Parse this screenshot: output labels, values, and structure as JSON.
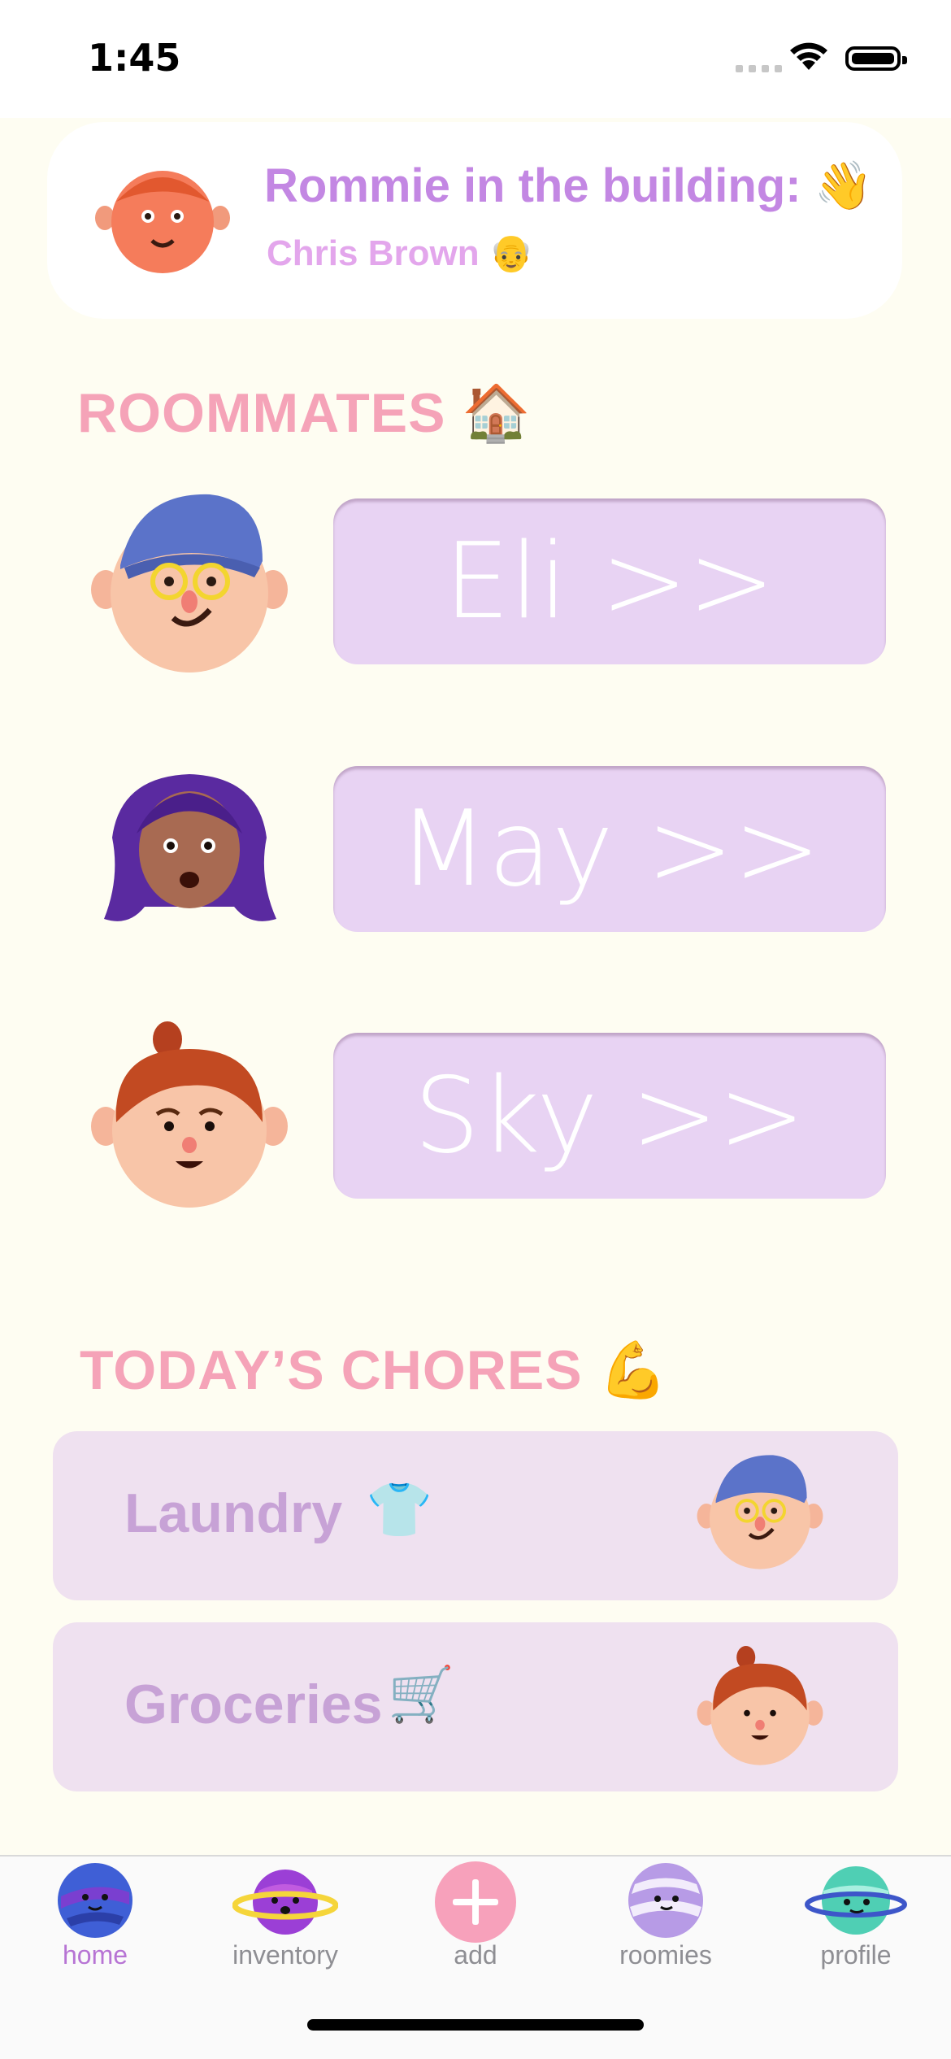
{
  "status_bar": {
    "time": "1:45"
  },
  "banner": {
    "title": "Rommie in the building: 👋",
    "subtitle": "Chris Brown 👴"
  },
  "roommates": {
    "title": "ROOMMATES 🏠",
    "items": [
      {
        "label": "Eli >>",
        "avatar": "boy-cap-glasses-avatar"
      },
      {
        "label": "May >>",
        "avatar": "girl-purple-hair-avatar"
      },
      {
        "label": "Sky >>",
        "avatar": "girl-bun-avatar"
      }
    ]
  },
  "chores": {
    "title": "TODAY’S CHORES 💪",
    "items": [
      {
        "label": "Laundry",
        "emoji": "👕",
        "assignee_avatar": "boy-cap-glasses-avatar"
      },
      {
        "label": "Groceries",
        "emoji": "🛒",
        "assignee_avatar": "girl-bun-avatar"
      }
    ]
  },
  "tab_bar": {
    "tabs": [
      {
        "label": "home",
        "icon": "planet-blue-icon",
        "active": true
      },
      {
        "label": "inventory",
        "icon": "planet-ring-icon",
        "active": false
      },
      {
        "label": "add",
        "icon": "plus-icon",
        "active": false
      },
      {
        "label": "roomies",
        "icon": "planet-striped-icon",
        "active": false
      },
      {
        "label": "profile",
        "icon": "planet-teal-icon",
        "active": false
      }
    ]
  },
  "colors": {
    "background": "#fefdf2",
    "accent_purple": "#c387e3",
    "section_pink": "#f5a3b8",
    "button_lilac": "#e8d3f3"
  }
}
